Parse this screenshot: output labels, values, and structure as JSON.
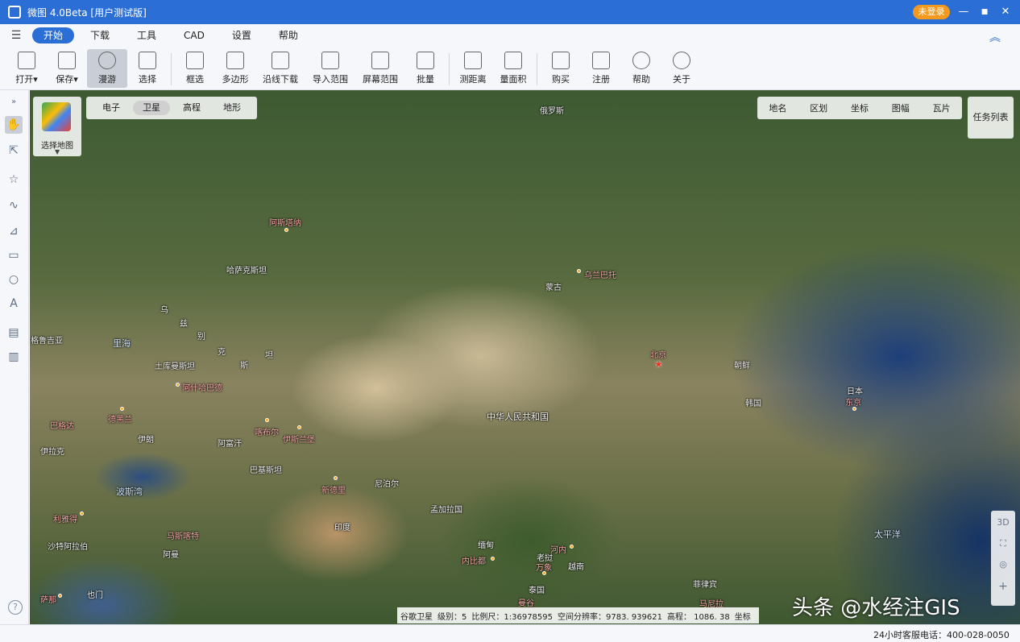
{
  "window": {
    "title": "微图 4.0Beta [用户测试版]",
    "login_badge": "未登录",
    "minimize": "—",
    "maximize": "■",
    "close": "✕"
  },
  "menu": {
    "items": [
      "开始",
      "下载",
      "工具",
      "CAD",
      "设置",
      "帮助"
    ]
  },
  "toolbar": {
    "items": [
      "打开▾",
      "保存▾",
      "漫游",
      "选择",
      "框选",
      "多边形",
      "沿线下载",
      "导入范围",
      "屏幕范围",
      "批量",
      "测距离",
      "量面积",
      "购买",
      "注册",
      "帮助",
      "关于"
    ]
  },
  "map": {
    "map_type_label": "选择地图",
    "layer_tabs": [
      "电子",
      "卫星",
      "高程",
      "地形"
    ],
    "overlay_tabs": [
      "地名",
      "区划",
      "坐标",
      "图幅",
      "瓦片"
    ],
    "task_list": "任务列表",
    "zoom_3d": "3D",
    "zoom_plus": "+",
    "places": [
      "俄罗斯",
      "哈萨克斯坦",
      "蒙古",
      "中华人民共和国",
      "北京",
      "朝鲜",
      "韩国",
      "日本",
      "东京",
      "太平洋",
      "里海",
      "土库曼斯坦",
      "伊朗",
      "阿富汗",
      "巴基斯坦",
      "尼泊尔",
      "印度",
      "孟加拉国",
      "缅甸",
      "泰国",
      "老挝",
      "越南",
      "菲律宾",
      "沙特阿拉伯",
      "阿曼",
      "也门",
      "波斯湾",
      "伊拉克",
      "格鲁吉亚",
      "乌",
      "兹",
      "别",
      "克",
      "斯",
      "坦",
      "新德里",
      "乌兰巴托",
      "阿什哈巴德",
      "喀布尔",
      "伊斯兰堡",
      "内比都",
      "河内",
      "万象",
      "曼谷",
      "马尼拉",
      "利雅得",
      "马斯喀特",
      "萨那",
      "德黑兰",
      "巴格达",
      "阿斯塔纳"
    ]
  },
  "status": {
    "source": "谷歌卫星",
    "level": "级别：5",
    "scale": "比例尺：1:36978595",
    "resolution": "空间分辨率：9783. 939621",
    "elevation": "高程：   1086. 38",
    "coord": "坐标"
  },
  "watermark": "头条 @水经注GIS",
  "footer": {
    "hotline": "24小时客服电话：400-028-0050"
  }
}
